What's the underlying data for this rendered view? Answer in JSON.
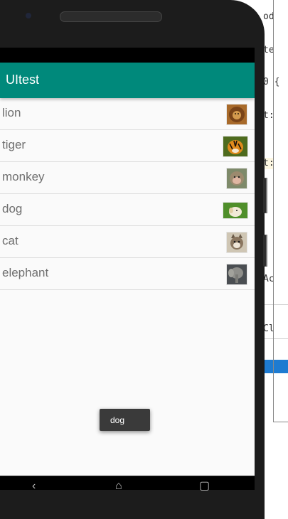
{
  "app": {
    "title": "UItest"
  },
  "animals": [
    {
      "name": "lion",
      "icon": "lion-photo"
    },
    {
      "name": "tiger",
      "icon": "tiger-photo"
    },
    {
      "name": "monkey",
      "icon": "monkey-photo"
    },
    {
      "name": "dog",
      "icon": "dog-photo"
    },
    {
      "name": "cat",
      "icon": "cat-photo"
    },
    {
      "name": "elephant",
      "icon": "elephant-photo"
    }
  ],
  "toast": {
    "text": "dog"
  },
  "ide": {
    "fragments": [
      "od",
      "te",
      "0 {",
      "t:",
      "t:",
      "Ac",
      "Cl"
    ]
  },
  "colors": {
    "appbar": "#00897b",
    "background": "#fafafa",
    "toast": "#3a3a3a"
  }
}
